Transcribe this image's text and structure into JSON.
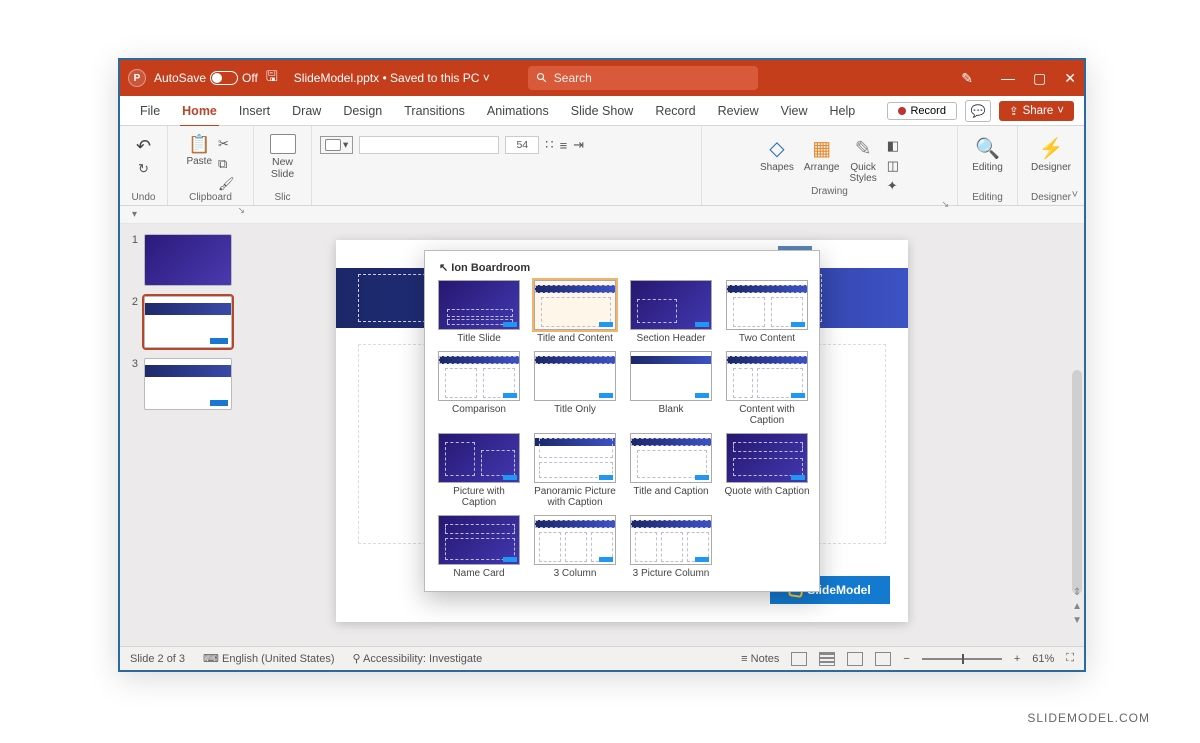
{
  "titlebar": {
    "autosave_label": "AutoSave",
    "autosave_state": "Off",
    "filename": "SlideModel.pptx",
    "save_location": "Saved to this PC",
    "search_placeholder": "Search"
  },
  "menu": {
    "items": [
      "File",
      "Home",
      "Insert",
      "Draw",
      "Design",
      "Transitions",
      "Animations",
      "Slide Show",
      "Record",
      "Review",
      "View",
      "Help"
    ],
    "active_index": 1,
    "record_btn": "Record",
    "share_btn": "Share"
  },
  "ribbon": {
    "undo_group": "Undo",
    "clipboard_group": "Clipboard",
    "paste_label": "Paste",
    "slides_group": "Slic",
    "new_slide_label": "New\nSlide",
    "font_size": "54",
    "drawing_group": "Drawing",
    "shapes_label": "Shapes",
    "arrange_label": "Arrange",
    "quickstyles_label": "Quick\nStyles",
    "editing_group": "Editing",
    "editing_label": "Editing",
    "designer_group": "Designer",
    "designer_label": "Designer"
  },
  "layout_gallery": {
    "theme_name": "Ion Boardroom",
    "selected_index": 1,
    "items": [
      "Title Slide",
      "Title and Content",
      "Section Header",
      "Two Content",
      "Comparison",
      "Title Only",
      "Blank",
      "Content with Caption",
      "Picture with Caption",
      "Panoramic Picture with Caption",
      "Title and Caption",
      "Quote with Caption",
      "Name Card",
      "3 Column",
      "3 Picture Column"
    ]
  },
  "thumbnails": {
    "count": 3,
    "selected": 2
  },
  "canvas": {
    "logo_text": "SlideModel"
  },
  "status": {
    "slide_indicator": "Slide 2 of 3",
    "language": "English (United States)",
    "accessibility": "Accessibility: Investigate",
    "notes_label": "Notes",
    "zoom": "61%"
  },
  "credit": "SLIDEMODEL.COM"
}
